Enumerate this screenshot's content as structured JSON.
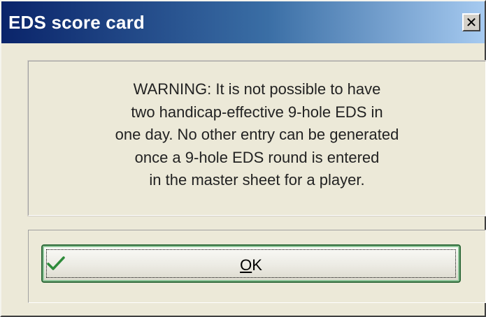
{
  "window": {
    "title": "EDS score card",
    "close_glyph": "✕"
  },
  "message": {
    "text": "WARNING: It is not possible to have\ntwo handicap-effective 9-hole EDS in\none day. No other entry can be generated\nonce a 9-hole EDS round is entered\nin the master sheet for a player."
  },
  "ok_button": {
    "mnemonic": "O",
    "label_rest": "K",
    "icon": "checkmark-icon",
    "icon_color": "#2e8b3a"
  },
  "colors": {
    "titlebar_start": "#0a246a",
    "titlebar_end": "#a6caf0",
    "dialog_bg": "#ece9d8",
    "button_border": "#2f6b3a"
  }
}
